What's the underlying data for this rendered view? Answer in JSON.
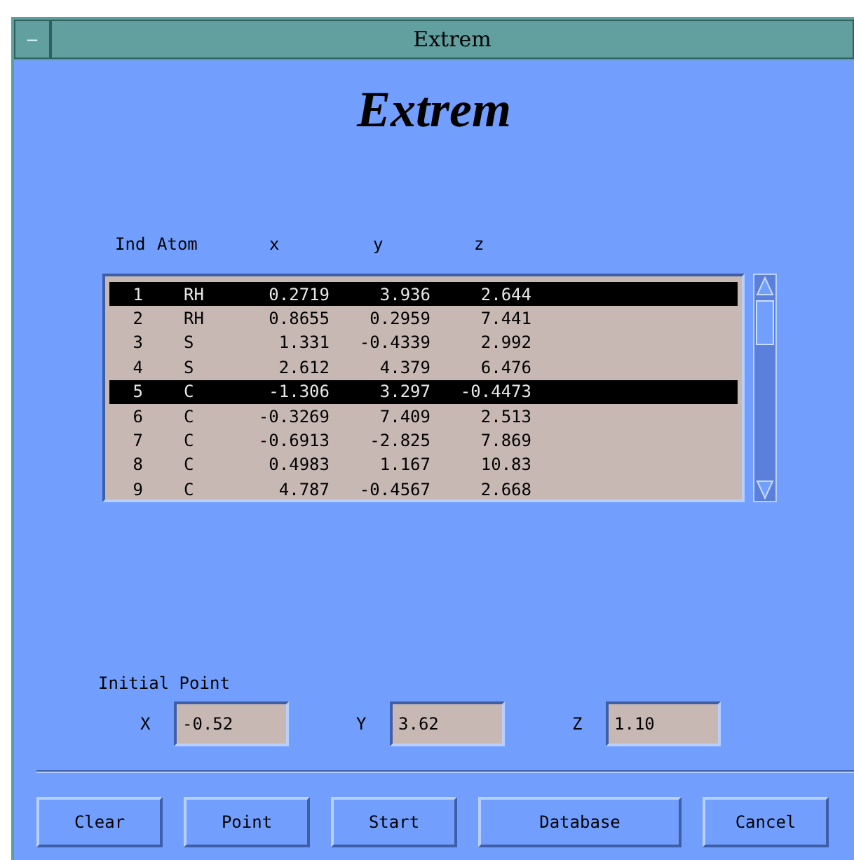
{
  "window": {
    "title": "Extrem",
    "menu_button": "—"
  },
  "heading": "Extrem",
  "table": {
    "columns": [
      "Ind",
      "Atom",
      "x",
      "y",
      "z"
    ],
    "rows": [
      {
        "cells": [
          "1",
          "RH",
          "0.2719",
          "3.936",
          "2.644"
        ],
        "selected": true
      },
      {
        "cells": [
          "2",
          "RH",
          "0.8655",
          "0.2959",
          "7.441"
        ],
        "selected": false
      },
      {
        "cells": [
          "3",
          "S",
          "1.331",
          "-0.4339",
          "2.992"
        ],
        "selected": false
      },
      {
        "cells": [
          "4",
          "S",
          "2.612",
          "4.379",
          "6.476"
        ],
        "selected": false
      },
      {
        "cells": [
          "5",
          "C",
          "-1.306",
          "3.297",
          "-0.4473"
        ],
        "selected": true
      },
      {
        "cells": [
          "6",
          "C",
          "-0.3269",
          "7.409",
          "2.513"
        ],
        "selected": false
      },
      {
        "cells": [
          "7",
          "C",
          "-0.6913",
          "-2.825",
          "7.869"
        ],
        "selected": false
      },
      {
        "cells": [
          "8",
          "C",
          "0.4983",
          "1.167",
          "10.83"
        ],
        "selected": false
      },
      {
        "cells": [
          "9",
          "C",
          "4.787",
          "-0.4567",
          "2.668"
        ],
        "selected": false
      }
    ]
  },
  "initial_point": {
    "label": "Initial Point",
    "fields": [
      {
        "label": "X",
        "value": "-0.52"
      },
      {
        "label": "Y",
        "value": "3.62"
      },
      {
        "label": "Z",
        "value": "1.10"
      }
    ]
  },
  "buttons": [
    "Clear",
    "Point",
    "Start",
    "Database",
    "Cancel"
  ]
}
